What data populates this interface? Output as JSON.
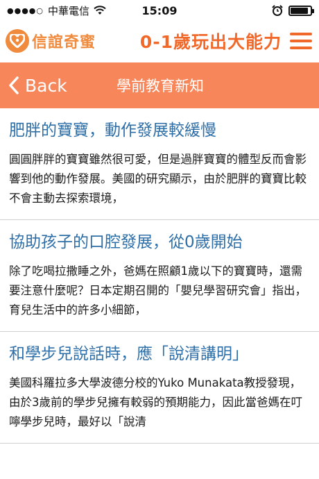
{
  "status_bar": {
    "carrier": "中華電信",
    "time": "15:09",
    "battery_level": 0.9
  },
  "header": {
    "logo_text": "信誼奇蜜",
    "slogan": "0-1歲玩出大能力",
    "brand_color": "#f08a3c"
  },
  "nav": {
    "back_label": "Back",
    "title": "學前教育新知",
    "bar_color": "#f7875a"
  },
  "articles": [
    {
      "title": "肥胖的寶寶，動作發展較緩慢",
      "excerpt": "圓圓胖胖的寶寶雖然很可愛，但是過胖寶寶的體型反而會影響到他的動作發展。美國的研究顯示，由於肥胖的寶寶比較不會主動去探索環境，"
    },
    {
      "title": "協助孩子的口腔發展，從0歲開始",
      "excerpt": "除了吃喝拉撒睡之外，爸媽在照顧1歲以下的寶寶時，還需要注意什麼呢？日本定期召開的「嬰兒學習研究會」指出，育兒生活中的許多小細節，"
    },
    {
      "title": "和學步兒說話時，應「說清講明」",
      "excerpt": "美國科羅拉多大學波德分校的Yuko Munakata教授發現，由於3歲前的學步兒擁有較弱的預期能力，因此當爸媽在叮嚀學步兒時，最好以「說清"
    }
  ]
}
